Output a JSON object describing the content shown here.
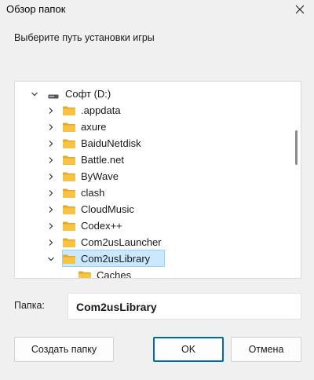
{
  "window": {
    "title": "Обзор папок"
  },
  "instruction": "Выберите путь установки игры",
  "tree": {
    "root": {
      "label": "Софт (D:)",
      "expanded": true,
      "icon": "drive-icon"
    },
    "items": [
      {
        "label": ".appdata",
        "expanded": false
      },
      {
        "label": "axure",
        "expanded": false
      },
      {
        "label": "BaiduNetdisk",
        "expanded": false
      },
      {
        "label": "Battle.net",
        "expanded": false
      },
      {
        "label": "ByWave",
        "expanded": false
      },
      {
        "label": "clash",
        "expanded": false
      },
      {
        "label": "CloudMusic",
        "expanded": false
      },
      {
        "label": "Codex++",
        "expanded": false
      },
      {
        "label": "Com2usLauncher",
        "expanded": false
      },
      {
        "label": "Com2usLibrary",
        "expanded": true,
        "selected": true
      },
      {
        "label": "Caches",
        "child": true
      }
    ]
  },
  "folder_field": {
    "label": "Папка:",
    "value": "Com2usLibrary"
  },
  "buttons": {
    "new_folder": "Создать папку",
    "ok": "OK",
    "cancel": "Отмена"
  },
  "colors": {
    "folder": "#f8c342",
    "folder_dark": "#e5a92a",
    "selection": "#cce8ff",
    "accent": "#0067c0"
  }
}
